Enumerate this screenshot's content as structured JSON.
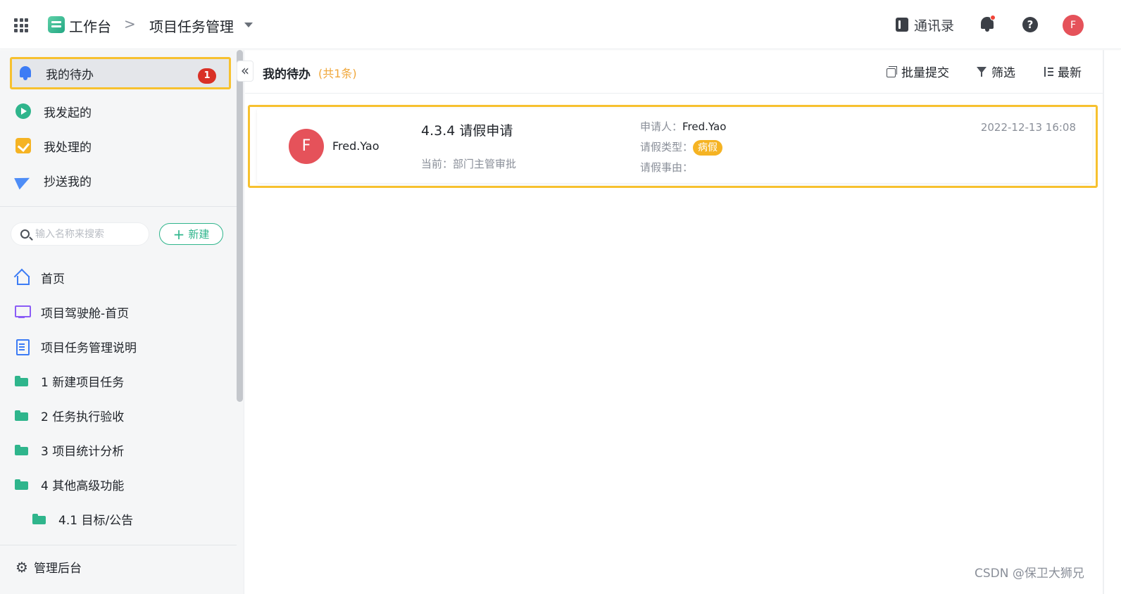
{
  "header": {
    "workspace_label": "工作台",
    "breadcrumb_sep": ">",
    "app_name": "项目任务管理",
    "contacts_label": "通讯录",
    "user_initial": "F"
  },
  "sidebar": {
    "inbox": [
      {
        "label": "我的待办",
        "icon": "bell-icon",
        "badge": "1",
        "active": true
      },
      {
        "label": "我发起的",
        "icon": "play-circle-icon"
      },
      {
        "label": "我处理的",
        "icon": "check-square-icon"
      },
      {
        "label": "抄送我的",
        "icon": "paper-plane-icon"
      }
    ],
    "search_placeholder": "输入名称来搜索",
    "new_button_label": "新建",
    "nav": [
      {
        "label": "首页",
        "icon": "home-icon"
      },
      {
        "label": "项目驾驶舱-首页",
        "icon": "monitor-icon"
      },
      {
        "label": "项目任务管理说明",
        "icon": "document-icon"
      },
      {
        "label": "1 新建项目任务",
        "icon": "folder-icon"
      },
      {
        "label": "2 任务执行验收",
        "icon": "folder-icon"
      },
      {
        "label": "3 项目统计分析",
        "icon": "folder-icon"
      },
      {
        "label": "4 其他高级功能",
        "icon": "folder-icon"
      },
      {
        "label": "4.1 目标/公告",
        "icon": "folder-icon"
      }
    ],
    "admin_label": "管理后台"
  },
  "main": {
    "title": "我的待办",
    "count_text": "(共1条)",
    "actions": {
      "batch_submit": "批量提交",
      "filter": "筛选",
      "sort": "最新"
    },
    "tasks": [
      {
        "avatar_initial": "F",
        "user_name": "Fred.Yao",
        "title": "4.3.4 请假申请",
        "status": "当前：部门主管审批",
        "applicant_label": "申请人：",
        "applicant_value": "Fred.Yao",
        "leave_type_label": "请假类型：",
        "leave_type_value": "病假",
        "reason_label": "请假事由：",
        "reason_value": "",
        "time": "2022-12-13 16:08"
      }
    ]
  },
  "watermark": "CSDN @保卫大狮兄",
  "colors": {
    "accent": "#2fb58c",
    "highlight": "#f7c12f",
    "badge": "#d93026",
    "avatar": "#e5525a",
    "tag": "#f5b323"
  }
}
